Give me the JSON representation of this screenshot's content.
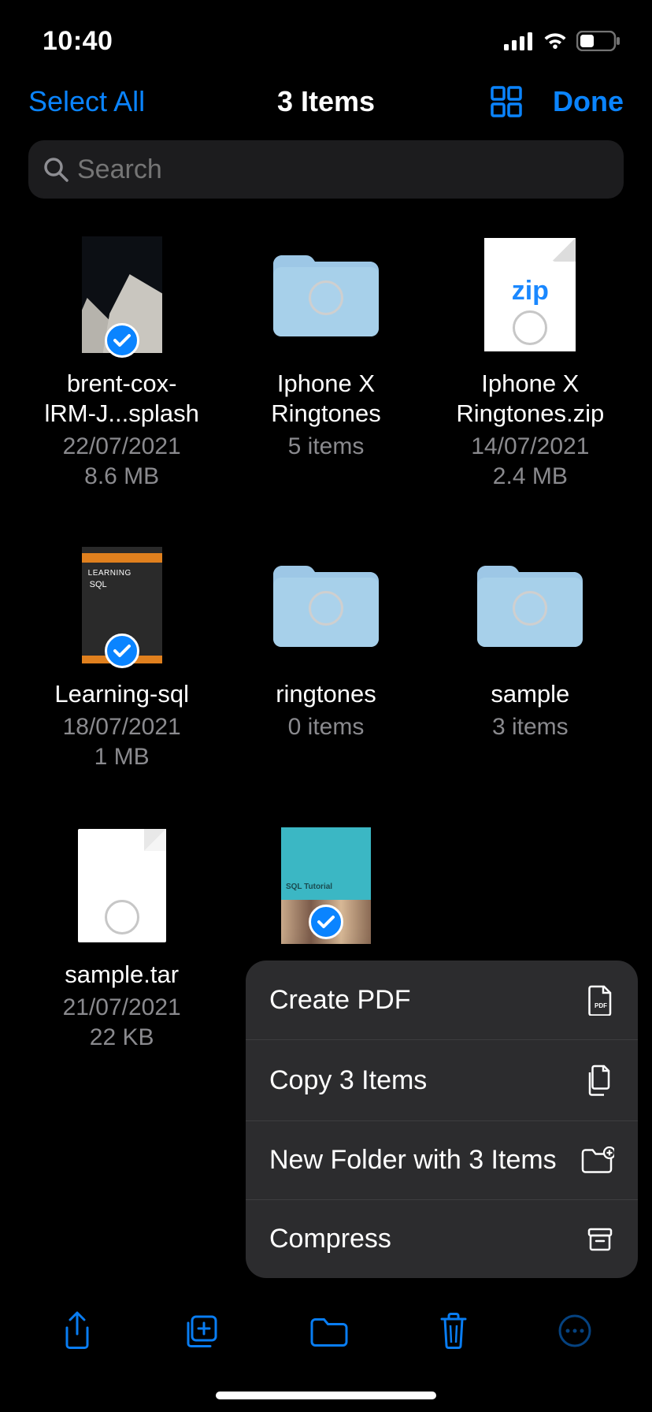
{
  "status": {
    "time": "10:40"
  },
  "nav": {
    "select_all": "Select All",
    "title": "3 Items",
    "done": "Done"
  },
  "search": {
    "placeholder": "Search"
  },
  "files": [
    {
      "name_line1": "brent-cox-",
      "name_line2": "lRM-J...splash",
      "date": "22/07/2021",
      "size": "8.6 MB"
    },
    {
      "name": "Iphone X Ringtones",
      "sub": "5 items"
    },
    {
      "name": "Iphone X Ringtones.zip",
      "date": "14/07/2021",
      "size": "2.4 MB",
      "zip_label": "zip"
    },
    {
      "name": "Learning-sql",
      "date": "18/07/2021",
      "size": "1 MB",
      "book_learning": "LEARNING",
      "book_sql": "SQL"
    },
    {
      "name": "ringtones",
      "sub": "0 items"
    },
    {
      "name": "sample",
      "sub": "3 items"
    },
    {
      "name": "sample.tar",
      "date": "21/07/2021",
      "size": "22 KB"
    },
    {
      "teal_label": "SQL Tutorial"
    }
  ],
  "menu": {
    "create_pdf": "Create PDF",
    "copy": "Copy 3 Items",
    "new_folder": "New Folder with 3 Items",
    "compress": "Compress"
  }
}
